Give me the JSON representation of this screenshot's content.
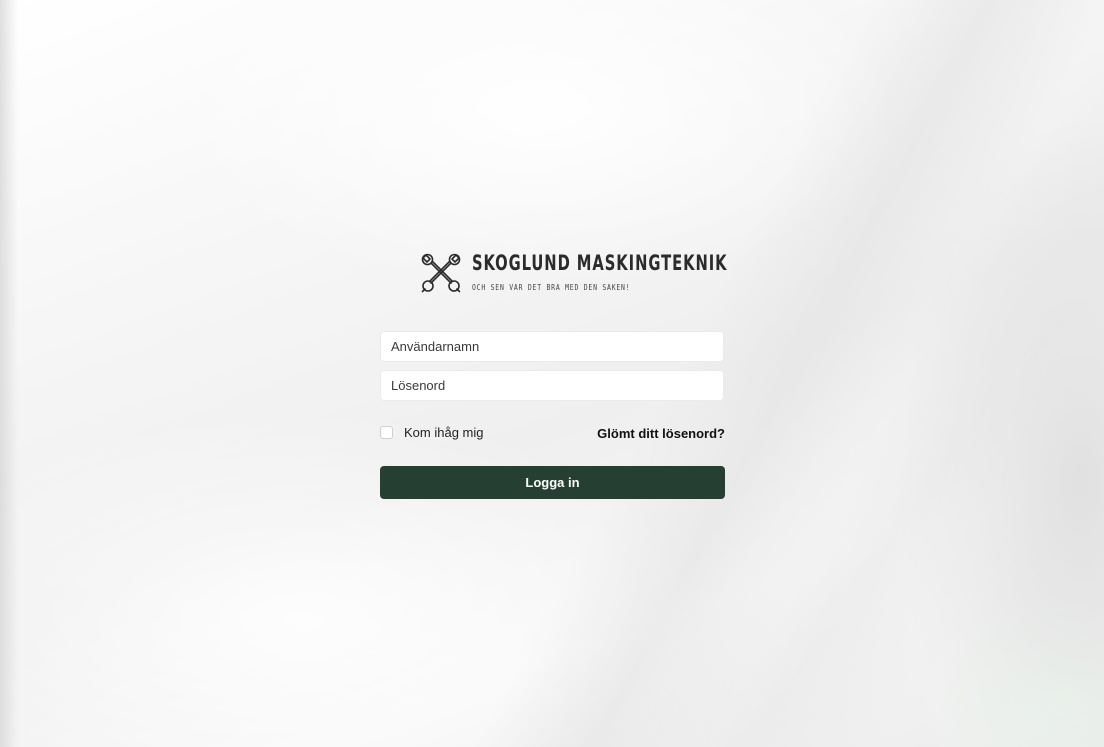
{
  "brand": {
    "title": "SKOGLUND MASKINGTEKNIK",
    "tagline": "OCH SEN VAR DET BRA MED DEN SAKEN!",
    "logo_icon": "crossed-wrenches-icon"
  },
  "login_form": {
    "username_placeholder": "Användarnamn",
    "username_value": "",
    "password_placeholder": "Lösenord",
    "password_value": "",
    "remember_label": "Kom ihåg mig",
    "remember_checked": false,
    "forgot_link": "Glömt ditt lösenord?",
    "submit_label": "Logga in"
  },
  "colors": {
    "primary_button": "#263f33",
    "button_text": "#ffffff",
    "background": "#f1f1f1"
  }
}
